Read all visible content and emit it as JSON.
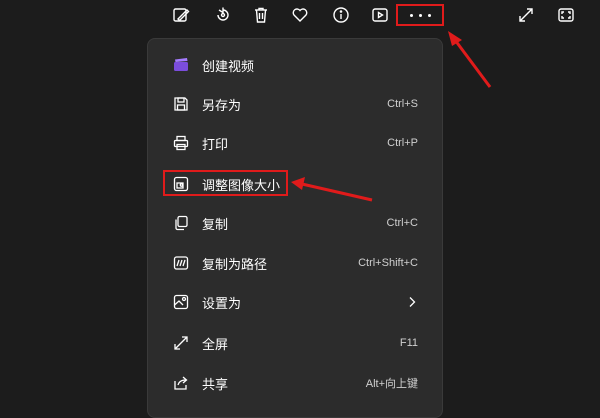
{
  "toolbar": {
    "icons": [
      "edit-image-icon",
      "rotate-icon",
      "delete-icon",
      "favorite-heart-icon",
      "info-icon",
      "slideshow-icon",
      "more-options-icon",
      "expand-icon",
      "fullscreen-icon"
    ]
  },
  "menu": {
    "items": [
      {
        "label": "创建视频",
        "shortcut": ""
      },
      {
        "label": "另存为",
        "shortcut": "Ctrl+S"
      },
      {
        "label": "打印",
        "shortcut": "Ctrl+P"
      },
      {
        "label": "调整图像大小",
        "shortcut": ""
      },
      {
        "label": "复制",
        "shortcut": "Ctrl+C"
      },
      {
        "label": "复制为路径",
        "shortcut": "Ctrl+Shift+C"
      },
      {
        "label": "设置为",
        "shortcut": ""
      },
      {
        "label": "全屏",
        "shortcut": "F11"
      },
      {
        "label": "共享",
        "shortcut": "Alt+向上键"
      }
    ]
  },
  "colors": {
    "background": "#1c1c1c",
    "menu_background": "#2c2c2c",
    "annotation_red": "#e01b1b",
    "video_icon_purple": "#7b4ddc"
  }
}
